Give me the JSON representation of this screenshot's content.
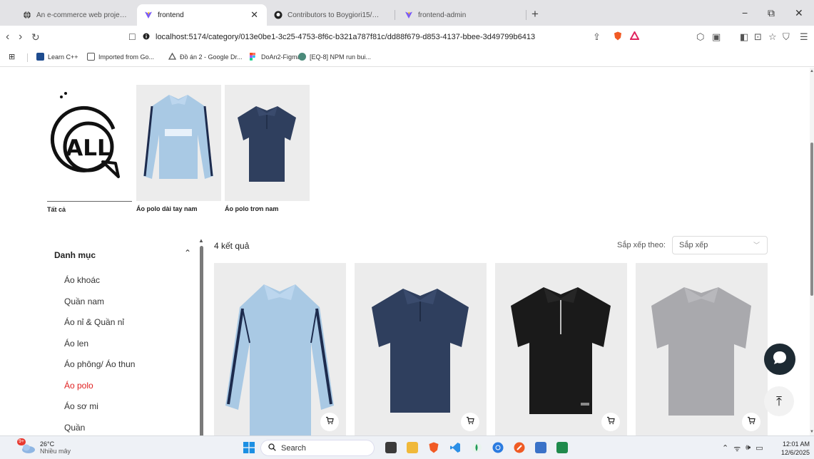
{
  "browser": {
    "tabs": [
      {
        "title": "An e-commerce web project - Cart it",
        "active": false
      },
      {
        "title": "frontend",
        "active": true
      },
      {
        "title": "Contributors to Boygiori15/DoAn2",
        "active": false
      },
      {
        "title": "frontend-admin",
        "active": false
      }
    ],
    "new_tab_glyph": "+",
    "window_controls": {
      "minimize": "−",
      "restore": "⧉",
      "close": "✕"
    },
    "url": "localhost:5174/category/013e0be1-3c25-4753-8f6c-b321a787f81c/dd88f679-d853-4137-bbee-3d49799b6413",
    "bookmarks": [
      {
        "label": "Learn C++",
        "icon": "learn-cpp-icon"
      },
      {
        "label": "Imported from Go...",
        "icon": "folder-icon"
      },
      {
        "label": "Đồ án 2 - Google Dr...",
        "icon": "google-drive-icon"
      },
      {
        "label": "DoAn2-Figma",
        "icon": "figma-icon"
      },
      {
        "label": "[EQ-8] NPM run bui...",
        "icon": "jira-icon"
      }
    ]
  },
  "categories": [
    {
      "label": "Tất cả",
      "image": "all-icon",
      "badge": "ALL"
    },
    {
      "label": "Áo polo dài tay nam",
      "image": "long-sleeve-polo-light-blue"
    },
    {
      "label": "Áo polo trơn nam",
      "image": "plain-polo-navy"
    }
  ],
  "sidebar": {
    "heading": "Danh mục",
    "items": [
      {
        "label": "Áo khoác",
        "active": false
      },
      {
        "label": "Quần nam",
        "active": false
      },
      {
        "label": "Áo nỉ & Quần nỉ",
        "active": false
      },
      {
        "label": "Áo len",
        "active": false
      },
      {
        "label": "Áo phông/ Áo thun",
        "active": false
      },
      {
        "label": "Áo polo",
        "active": true
      },
      {
        "label": "Áo sơ mi",
        "active": false
      },
      {
        "label": "Quần",
        "active": false
      }
    ]
  },
  "results": {
    "count_text": "4 kết quả",
    "sort_label": "Sắp xếp theo:",
    "sort_value": "Sắp xếp"
  },
  "products": [
    {
      "image": "long-sleeve-polo-light-blue",
      "color": "#a9c9e4",
      "cart_icon": "cart-icon"
    },
    {
      "image": "polo-navy",
      "color": "#2f3f5e",
      "cart_icon": "cart-icon"
    },
    {
      "image": "zip-polo-black",
      "color": "#1a1a1a",
      "cart_icon": "cart-icon"
    },
    {
      "image": "polo-grey",
      "color": "#a9a9ad",
      "cart_icon": "cart-icon"
    }
  ],
  "floating": {
    "chat_icon": "chat-icon",
    "scroll_top_icon": "arrow-up-icon",
    "scroll_top_glyph": "⤒"
  },
  "taskbar": {
    "weather": {
      "temp": "26°C",
      "condition": "Nhiều mây",
      "badge": "9+"
    },
    "search_placeholder": "Search",
    "clock": {
      "time": "12:01 AM",
      "date": "12/6/2025"
    }
  },
  "colors": {
    "accent_red": "#e02020",
    "chat_button": "#1d2a33"
  }
}
